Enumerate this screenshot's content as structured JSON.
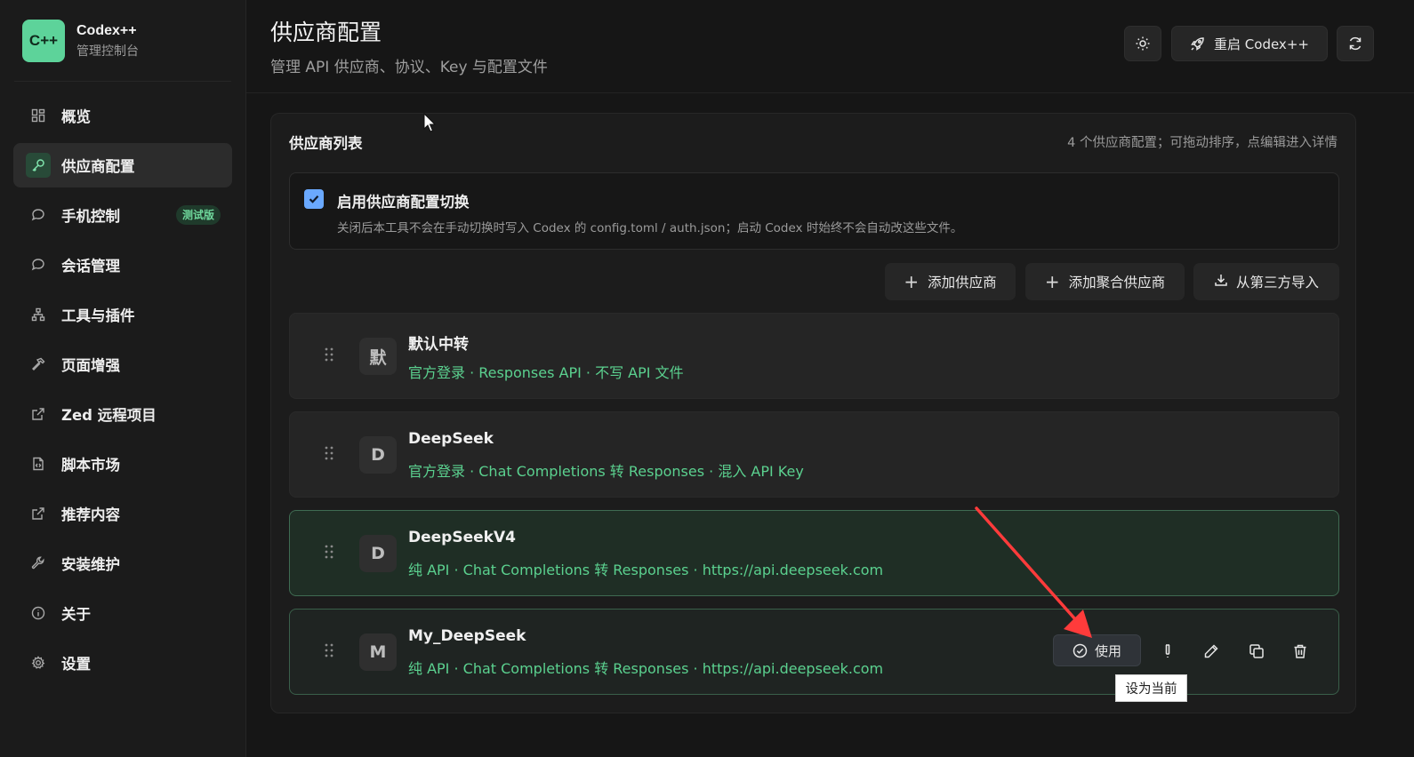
{
  "app": {
    "logo_text": "C++",
    "title": "Codex++",
    "subtitle": "管理控制台"
  },
  "sidebar": {
    "items": [
      {
        "label": "概览",
        "icon": "grid-icon"
      },
      {
        "label": "供应商配置",
        "icon": "key-icon",
        "active": true
      },
      {
        "label": "手机控制",
        "icon": "chat-bubble-icon",
        "badge": "测试版"
      },
      {
        "label": "会话管理",
        "icon": "chat-bubble-icon"
      },
      {
        "label": "工具与插件",
        "icon": "sitemap-icon"
      },
      {
        "label": "页面增强",
        "icon": "hammer-icon"
      },
      {
        "label": "Zed 远程项目",
        "icon": "external-link-icon"
      },
      {
        "label": "脚本市场",
        "icon": "file-code-icon"
      },
      {
        "label": "推荐内容",
        "icon": "external-link-icon"
      },
      {
        "label": "安装维护",
        "icon": "wrench-icon"
      },
      {
        "label": "关于",
        "icon": "info-icon"
      },
      {
        "label": "设置",
        "icon": "gear-icon"
      }
    ]
  },
  "header": {
    "title": "供应商配置",
    "subtitle": "管理 API 供应商、协议、Key 与配置文件",
    "restart_label": "重启 Codex++"
  },
  "panel": {
    "title": "供应商列表",
    "hint": "4 个供应商配置；可拖动排序，点编辑进入详情",
    "toggle": {
      "checked": true,
      "label": "启用供应商配置切换",
      "description": "关闭后本工具不会在手动切换时写入 Codex 的 config.toml / auth.json；启动 Codex 时始终不会自动改这些文件。"
    },
    "actions": {
      "add_provider": "添加供应商",
      "add_aggregate": "添加聚合供应商",
      "import_third_party": "从第三方导入"
    },
    "providers": [
      {
        "avatar": "默",
        "name": "默认中转",
        "desc": "官方登录 · Responses API · 不写 API 文件",
        "state": "normal"
      },
      {
        "avatar": "D",
        "name": "DeepSeek",
        "desc": "官方登录 · Chat Completions 转 Responses · 混入 API Key",
        "state": "normal"
      },
      {
        "avatar": "D",
        "name": "DeepSeekV4",
        "desc": "纯 API · Chat Completions 转 Responses · https://api.deepseek.com",
        "state": "current"
      },
      {
        "avatar": "M",
        "name": "My_DeepSeek",
        "desc": "纯 API · Chat Completions 转 Responses · https://api.deepseek.com",
        "state": "hover"
      }
    ],
    "use_label": "使用",
    "tooltip": "设为当前"
  },
  "colors": {
    "accent": "#5bd18f",
    "logo_bg": "#5dd39a",
    "checkbox": "#6aa9ff",
    "annotation_arrow": "#ff3b3b"
  }
}
